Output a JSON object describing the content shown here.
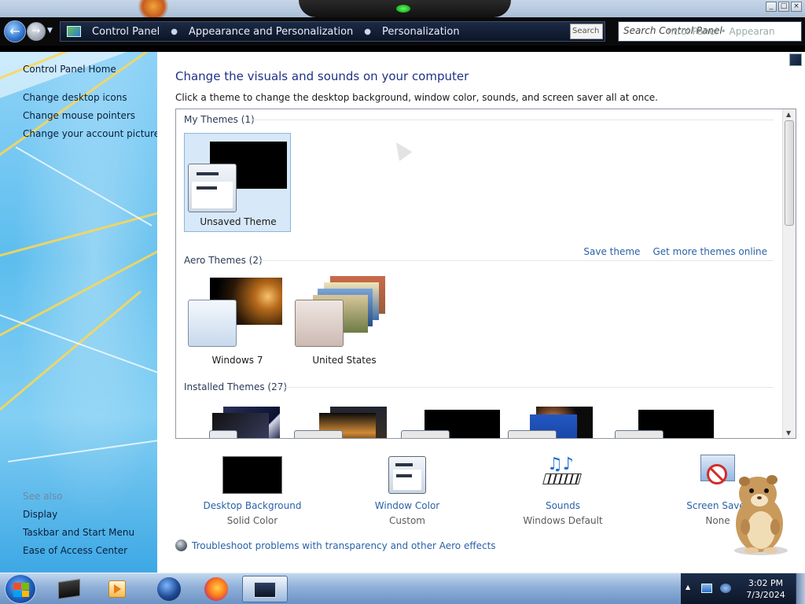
{
  "window": {
    "buttons": {
      "minimize": "_",
      "maximize": "□",
      "close": "×"
    }
  },
  "address": {
    "breadcrumbs": [
      "Control Panel",
      "Appearance and Personalization",
      "Personalization"
    ],
    "refresh_label": "Search",
    "search_placeholder": "Search Control Panel",
    "search_ghost": "ntrol Panel    •  Appearan"
  },
  "sidebar": {
    "home": "Control Panel Home",
    "links": [
      "Change desktop icons",
      "Change mouse pointers",
      "Change your account picture"
    ],
    "see_also_heading": "See also",
    "see_also": [
      "Display",
      "Taskbar and Start Menu",
      "Ease of Access Center"
    ]
  },
  "main": {
    "title": "Change the visuals and sounds on your computer",
    "intro": "Click a theme to change the desktop background, window color, sounds, and screen saver all at once.",
    "groups": [
      {
        "heading": "My Themes (1)",
        "themes": [
          {
            "label": "Unsaved Theme",
            "selected": true
          }
        ]
      },
      {
        "heading": "Aero Themes (2)",
        "themes": [
          {
            "label": "Windows 7"
          },
          {
            "label": "United States"
          }
        ]
      },
      {
        "heading": "Installed Themes (27)",
        "themes": []
      }
    ],
    "actions": {
      "save_theme": "Save theme",
      "get_more": "Get more themes online"
    },
    "tiles": [
      {
        "label": "Desktop Background",
        "value": "Solid Color",
        "icon": "desktop-background-icon"
      },
      {
        "label": "Window Color",
        "value": "Custom",
        "icon": "window-color-icon"
      },
      {
        "label": "Sounds",
        "value": "Windows Default",
        "icon": "sounds-icon"
      },
      {
        "label": "Screen Saver",
        "value": "None",
        "icon": "screen-saver-icon"
      }
    ],
    "troubleshoot": "Troubleshoot problems with transparency and other Aero effects"
  },
  "taskbar": {
    "apps": [
      "command-prompt-icon",
      "media-player-icon",
      "globe-icon",
      "firefox-icon",
      "personalization-window-icon"
    ],
    "time": "3:02 PM",
    "date": "7/3/2024"
  },
  "colors": {
    "link": "#2a62a8",
    "title": "#1e3287",
    "selection": "#d7e8f8"
  }
}
